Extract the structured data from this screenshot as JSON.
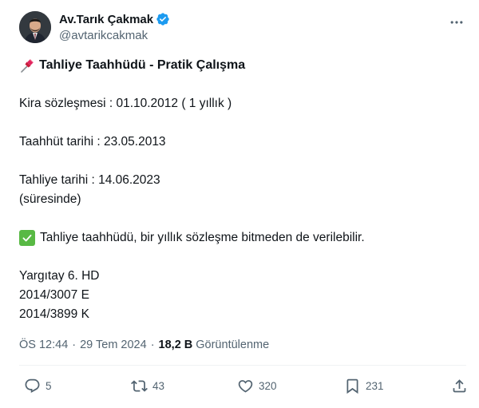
{
  "author": {
    "display_name": "Av.Tarık Çakmak",
    "handle": "@avtarikcakmak",
    "verified": true,
    "avatar_icon": "profile-photo"
  },
  "more_icon": "more-horizontal-icon",
  "tweet": {
    "title": "Tahliye Taahhüdü - Pratik Çalışma",
    "lines": {
      "kira": "Kira sözleşmesi : 01.10.2012 ( 1 yıllık )",
      "taahhut": "Taahhüt tarihi : 23.05.2013",
      "tahliye": "Tahliye tarihi : 14.06.2023",
      "suresinde": "(süresinde)",
      "result": "Tahliye taahhüdü, bir yıllık sözleşme bitmeden de verilebilir.",
      "yargitay": "Yargıtay 6. HD",
      "esas": "2014/3007 E",
      "karar": "2014/3899 K"
    }
  },
  "meta": {
    "time": "ÖS 12:44",
    "dot": "·",
    "date": "29 Tem 2024",
    "views_count": "18,2 B",
    "views_label": "Görüntülenme"
  },
  "actions": {
    "reply_count": "5",
    "retweet_count": "43",
    "like_count": "320",
    "bookmark_count": "231"
  },
  "colors": {
    "text": "#0f1419",
    "secondary": "#536471",
    "verified": "#1d9bf0",
    "check_green": "#58b944",
    "pin_red": "#e0245e"
  }
}
